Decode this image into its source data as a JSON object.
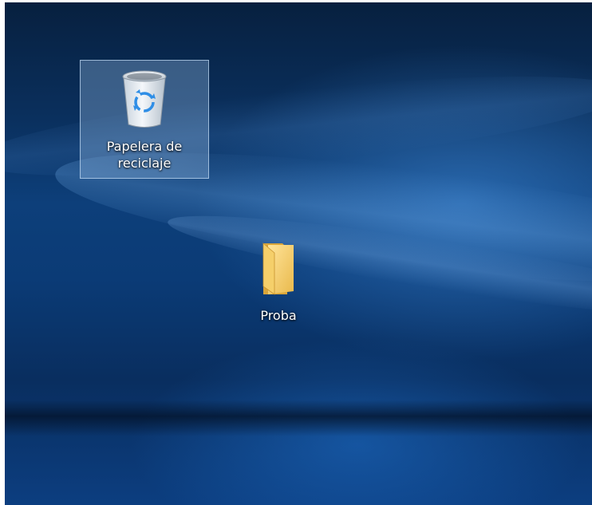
{
  "desktop": {
    "wallpaper": "windows-10-hero",
    "icons": [
      {
        "label": "Papelera de reciclaje",
        "label_line1": "Papelera de",
        "label_line2": "reciclaje",
        "icon": "recycle-bin-icon",
        "selected": true
      },
      {
        "label": "Proba",
        "icon": "folder-icon",
        "selected": false
      }
    ]
  },
  "colors": {
    "wallpaper_dark": "#07203f",
    "wallpaper_blue": "#0d3f7a",
    "selection_fill": "#8cb4dc",
    "folder_yellow": "#f5cf6a",
    "recycle_symbol": "#2f8ee6"
  }
}
